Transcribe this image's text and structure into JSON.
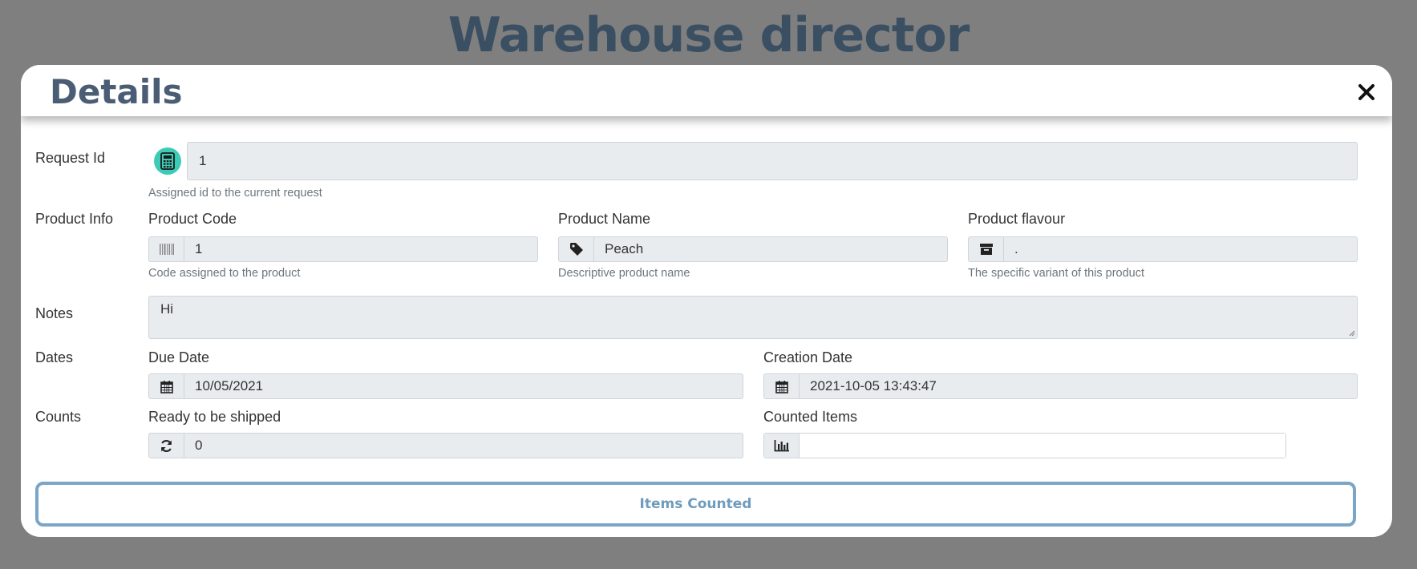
{
  "app": {
    "title": "Warehouse director"
  },
  "modal": {
    "title": "Details",
    "close_icon": "close-icon"
  },
  "request": {
    "label": "Request Id",
    "value": "1",
    "help": "Assigned id to the current request",
    "icon": "calculator-icon"
  },
  "product": {
    "label": "Product Info",
    "code": {
      "label": "Product Code",
      "value": "1",
      "help": "Code assigned to the product",
      "icon": "barcode-icon"
    },
    "name": {
      "label": "Product Name",
      "value": "Peach",
      "help": "Descriptive product name",
      "icon": "tag-icon"
    },
    "flavour": {
      "label": "Product flavour",
      "value": ".",
      "help": "The specific variant of this product",
      "icon": "archive-icon"
    }
  },
  "notes": {
    "label": "Notes",
    "value": "Hi"
  },
  "dates": {
    "label": "Dates",
    "due": {
      "label": "Due Date",
      "value": "10/05/2021",
      "icon": "calendar-icon"
    },
    "created": {
      "label": "Creation Date",
      "value": "2021-10-05 13:43:47",
      "icon": "calendar-icon"
    }
  },
  "counts": {
    "label": "Counts",
    "ready": {
      "label": "Ready to be shipped",
      "value": "0",
      "icon": "refresh-icon"
    },
    "counted": {
      "label": "Counted Items",
      "value": "",
      "icon": "bar-chart-icon"
    }
  },
  "submit": {
    "label": "Items Counted"
  },
  "colors": {
    "backdrop": "#7f7f7f",
    "title": "#3b4f63",
    "accent_teal": "#3ecbb5",
    "button_border": "#7aa5c6"
  }
}
